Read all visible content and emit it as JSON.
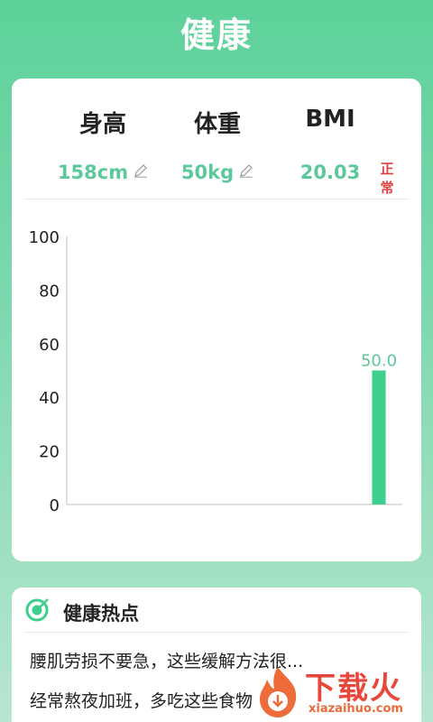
{
  "header": {
    "title": "健康"
  },
  "stats": [
    {
      "label": "身高",
      "value": "158cm",
      "editable": true
    },
    {
      "label": "体重",
      "value": "50kg",
      "editable": true
    },
    {
      "label": "BMI",
      "value": "20.03",
      "badge": "正常"
    }
  ],
  "colors": {
    "accent": "#5cc99a",
    "bar": "#3ecf8e",
    "badge": "#e0413f",
    "header_gradient_top": "#5dd19a"
  },
  "chart_data": {
    "type": "bar",
    "categories": [
      ""
    ],
    "values": [
      50.0
    ],
    "data_labels": [
      "50.0"
    ],
    "ylim": [
      0,
      100
    ],
    "yticks": [
      "0",
      "20",
      "40",
      "60",
      "80",
      "100"
    ],
    "title": "",
    "xlabel": "",
    "ylabel": "",
    "grid": false
  },
  "hot": {
    "title": "健康热点",
    "icon": "target-icon",
    "items": [
      "腰肌劳损不要急，这些缓解方法很...",
      "经常熬夜加班，多吃这些食物"
    ]
  },
  "watermark": {
    "text": "下载火",
    "url": "xiazaihuo.com"
  }
}
